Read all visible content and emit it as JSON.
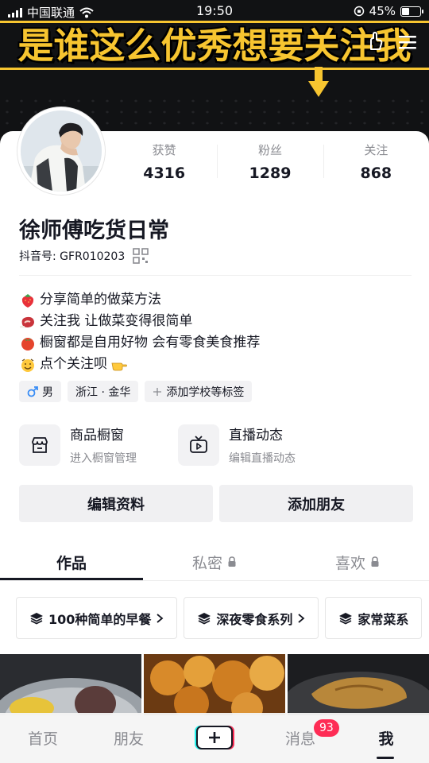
{
  "status_bar": {
    "carrier": "中国联通",
    "time": "19:50",
    "battery": "45%",
    "battery_level": 0.45
  },
  "banner": {
    "title": "是谁这么优秀想要关注我"
  },
  "profile": {
    "avatar": "avatar",
    "stats": [
      {
        "label": "获赞",
        "value": "4316"
      },
      {
        "label": "粉丝",
        "value": "1289"
      },
      {
        "label": "关注",
        "value": "868"
      }
    ],
    "nickname": "徐师傅吃货日常",
    "douyin_id": "抖音号: GFR010203",
    "bio": [
      {
        "icon": "strawberry",
        "text": "分享简单的做菜方法"
      },
      {
        "icon": "meat",
        "text": "关注我 让做菜变得很简单"
      },
      {
        "icon": "tomato",
        "text": "橱窗都是自用好物 会有零食美食推荐"
      },
      {
        "icon": "smiling-face",
        "text": "点个关注呗",
        "trailing_icon": "pointing-hand"
      }
    ],
    "tags": [
      {
        "icon": "male-icon",
        "text": "男"
      },
      {
        "text": "浙江 · 金华"
      },
      {
        "icon": "plus-icon",
        "text": "添加学校等标签"
      }
    ]
  },
  "entries": [
    {
      "title": "商品橱窗",
      "subtitle": "进入橱窗管理",
      "icon": "shop-window-icon"
    },
    {
      "title": "直播动态",
      "subtitle": "编辑直播动态",
      "icon": "live-tv-icon"
    }
  ],
  "buttons": {
    "edit": "编辑资料",
    "add_friend": "添加朋友"
  },
  "tabs": [
    {
      "label": "作品",
      "active": true
    },
    {
      "label": "私密",
      "locked": true
    },
    {
      "label": "喜欢",
      "locked": true
    }
  ],
  "collections": [
    {
      "label": "100种简单的早餐"
    },
    {
      "label": "深夜零食系列"
    },
    {
      "label": "家常菜系"
    }
  ],
  "bottom_nav": {
    "items": [
      {
        "label": "首页"
      },
      {
        "label": "朋友"
      },
      {
        "label": "消息"
      },
      {
        "label": "我",
        "active": true
      }
    ],
    "message_badge": "93"
  },
  "colors": {
    "accent": "#fe2c55",
    "banner_text": "#f7c530",
    "text": "#161823",
    "secondary": "#8a8b91"
  }
}
